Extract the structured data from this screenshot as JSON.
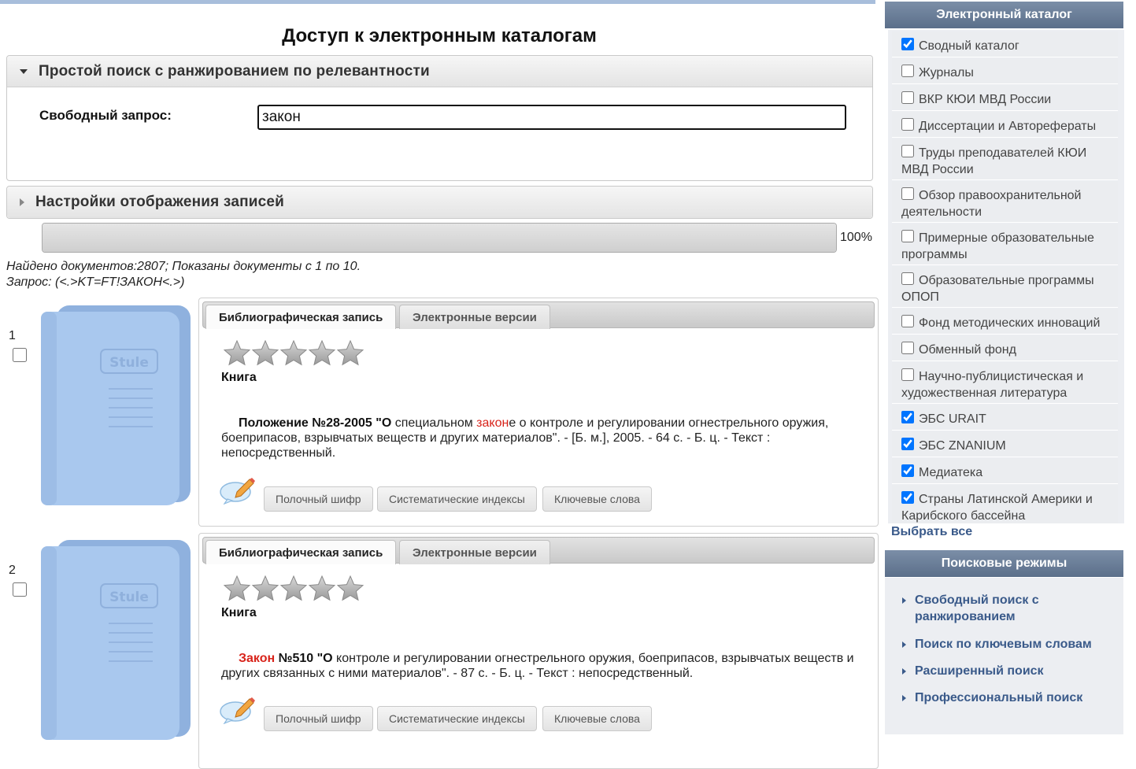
{
  "page": {
    "title": "Доступ к электронным каталогам"
  },
  "simple_search": {
    "header": "Простой поиск с ранжированием по релевантности",
    "query_label": "Свободный запрос:",
    "query_value": "закон"
  },
  "display_settings": {
    "header": "Настройки отображения записей"
  },
  "progress": {
    "percent": 100,
    "label": "100%"
  },
  "results": {
    "found_text": "Найдено документов:2807; Показаны документы с 1 по 10.",
    "query_text": "Запрос:  (<.>KT=FT!ЗАКОН<.>)"
  },
  "record_tabs": {
    "biblio": "Библиографическая запись",
    "electronic": "Электронные версии"
  },
  "record_buttons": {
    "shelf": "Полочный шифр",
    "systematic": "Систематические индексы",
    "keywords": "Ключевые слова"
  },
  "records": [
    {
      "number": "1",
      "rating": 0,
      "type": "Книга",
      "desc_bold_pre": "Положение №28-2005 \"О",
      "desc_text1": " специальном ",
      "desc_hl": "закон",
      "desc_text2": "е о контроле и регулировании огнестрельного оружия, боеприпасов, взрывчатых веществ и других материалов\". - [Б. м.], 2005. - 64 с. - Б. ц. - Текст : непосредственный."
    },
    {
      "number": "2",
      "rating": 0,
      "type": "Книга",
      "desc_hl": "Закон",
      "desc_bold_post": " №510 \"О",
      "desc_text2": " контроле и регулировании огнестрельного оружия, боеприпасов, взрывчатых веществ и других связанных с ними материалов\". - 87 с. - Б. ц. - Текст : непосредственный."
    }
  ],
  "book_cover_label": "Stule",
  "sidebar": {
    "catalog_header": "Электронный каталог",
    "catalogs": [
      {
        "label": "Сводный каталог",
        "checked": true
      },
      {
        "label": "Журналы",
        "checked": false
      },
      {
        "label": "ВКР КЮИ МВД России",
        "checked": false
      },
      {
        "label": "Диссертации и Авторефераты",
        "checked": false
      },
      {
        "label": "Труды преподавателей КЮИ МВД России",
        "checked": false
      },
      {
        "label": "Обзор правоохранительной деятельности",
        "checked": false
      },
      {
        "label": "Примерные образовательные программы",
        "checked": false
      },
      {
        "label": "Образовательные программы ОПОП",
        "checked": false
      },
      {
        "label": "Фонд методических инноваций",
        "checked": false
      },
      {
        "label": "Обменный фонд",
        "checked": false
      },
      {
        "label": "Научно-публицистическая и художественная литература",
        "checked": false
      },
      {
        "label": "ЭБС URAIT",
        "checked": true
      },
      {
        "label": "ЭБС ZNANIUM",
        "checked": true
      },
      {
        "label": "Медиатека",
        "checked": true
      },
      {
        "label": "Страны Латинской Америки и Карибского бассейна",
        "checked": true
      }
    ],
    "select_all": "Выбрать все",
    "modes_header": "Поисковые режимы",
    "modes": [
      "Свободный поиск с ранжированием",
      "Поиск по ключевым словам",
      "Расширенный поиск",
      "Профессиональный поиск"
    ]
  },
  "colors": {
    "highlight": "#d8231a",
    "link": "#3a5a8a",
    "sidebar_header": "#6a7e98",
    "book": "#a9c8ee"
  }
}
